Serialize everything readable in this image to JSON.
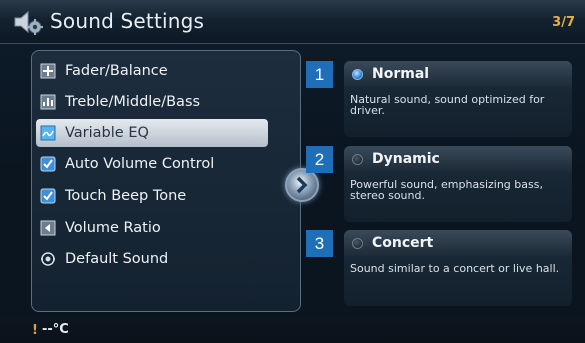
{
  "header": {
    "title": "Sound Settings",
    "page": "3/7",
    "icon": "speaker-gear-icon"
  },
  "menu": {
    "items": [
      {
        "label": "Fader/Balance",
        "icon": "fader-icon",
        "selected": false
      },
      {
        "label": "Treble/Middle/Bass",
        "icon": "equalizer-icon",
        "selected": false
      },
      {
        "label": "Variable EQ",
        "icon": "variable-eq-icon",
        "selected": true
      },
      {
        "label": "Auto Volume Control",
        "icon": "checkbox-checked-icon",
        "selected": false
      },
      {
        "label": "Touch Beep Tone",
        "icon": "checkbox-checked-icon",
        "selected": false
      },
      {
        "label": "Volume Ratio",
        "icon": "volume-ratio-icon",
        "selected": false
      },
      {
        "label": "Default Sound",
        "icon": "default-sound-icon",
        "selected": false
      }
    ]
  },
  "options": [
    {
      "badge": "1",
      "label": "Normal",
      "selected": true,
      "description": "Natural sound, sound optimized for driver."
    },
    {
      "badge": "2",
      "label": "Dynamic",
      "selected": false,
      "description": "Powerful sound, emphasizing bass, stereo sound."
    },
    {
      "badge": "3",
      "label": "Concert",
      "selected": false,
      "description": "Sound similar to a concert or live hall."
    }
  ],
  "status": {
    "warning": "!",
    "temperature": "--°C"
  },
  "colors": {
    "accent": "#e2b14a",
    "badge": "#1f6fb8",
    "selected_radio": "#3a8ad8"
  }
}
